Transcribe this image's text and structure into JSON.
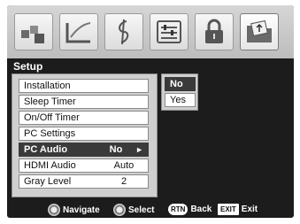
{
  "menu": {
    "title": "Setup",
    "items": [
      {
        "label": "Installation",
        "value": ""
      },
      {
        "label": "Sleep Timer",
        "value": ""
      },
      {
        "label": "On/Off Timer",
        "value": ""
      },
      {
        "label": "PC Settings",
        "value": ""
      },
      {
        "label": "PC Audio",
        "value": "No",
        "arrow": "►"
      },
      {
        "label": "HDMI Audio",
        "value": "Auto"
      },
      {
        "label": "Gray Level",
        "value": "2"
      }
    ]
  },
  "submenu": {
    "options": [
      "No",
      "Yes"
    ],
    "selected": "No"
  },
  "icons": [
    "picture-icon",
    "sound-icon",
    "music-icon",
    "settings-sliders-icon",
    "lock-icon",
    "setup-folder-icon"
  ],
  "nav": {
    "navigate": "Navigate",
    "select": "Select",
    "back_key": "RTN",
    "back": "Back",
    "exit_key": "EXIT",
    "exit": "Exit"
  },
  "colors": {
    "screen_bg": "#1c1c1c",
    "selected_bg": "#3a3a3a",
    "panel_bg": "#cfcfcf"
  }
}
